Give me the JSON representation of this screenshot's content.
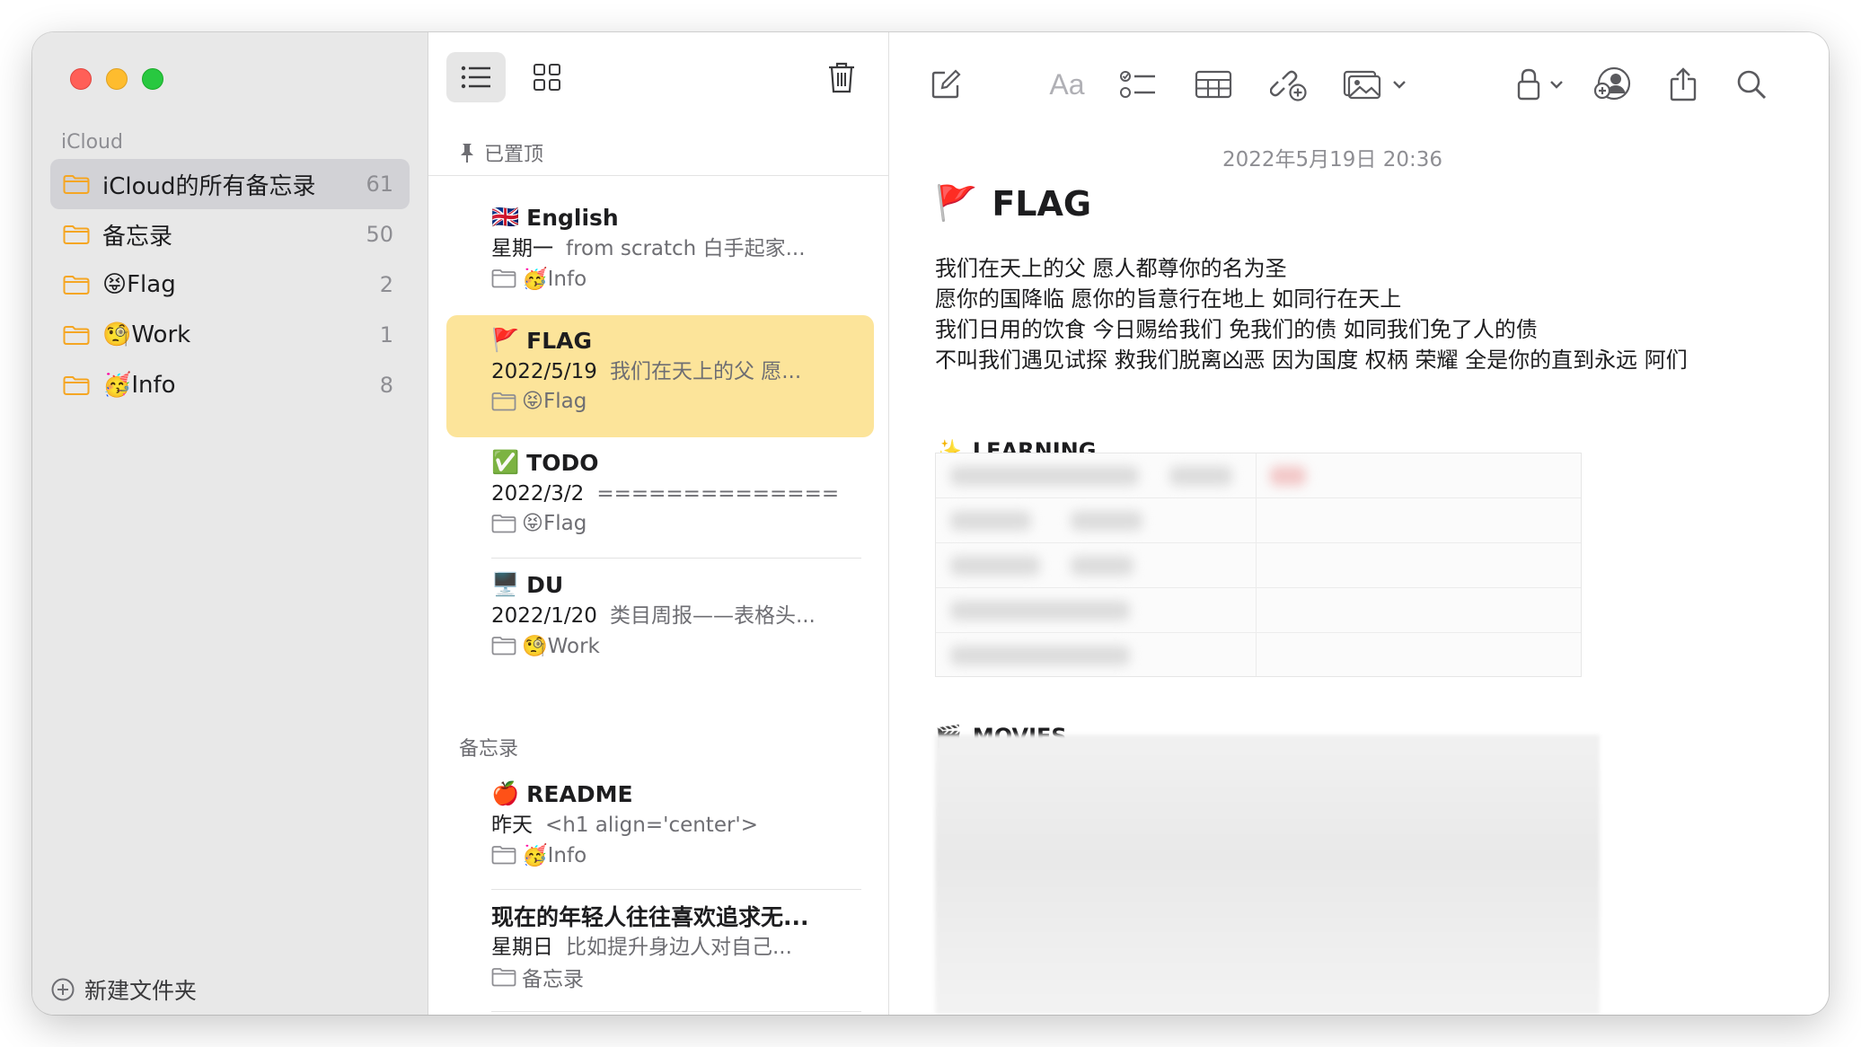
{
  "window": {
    "traffic_lights": {
      "close": "#ff5f57",
      "minimize": "#febc2e",
      "maximize": "#28c840"
    }
  },
  "sidebar": {
    "account_label": "iCloud",
    "folders": [
      {
        "name": "iCloud的所有备忘录",
        "count": "61",
        "selected": true
      },
      {
        "name": "备忘录",
        "count": "50"
      },
      {
        "name": "😝Flag",
        "count": "2"
      },
      {
        "name": "🧐Work",
        "count": "1"
      },
      {
        "name": "🥳Info",
        "count": "8"
      }
    ],
    "new_folder_label": "新建文件夹",
    "folder_icon_color": "#f5a623"
  },
  "note_list": {
    "toolbar": {
      "list_view_icon": "list-icon",
      "gallery_view_icon": "grid-icon",
      "delete_icon": "trash-icon"
    },
    "pinned_header": "已置顶",
    "pinned_notes": [
      {
        "emoji": "🇬🇧",
        "title": "English",
        "date": "星期一",
        "snippet": "from scratch 白手起家...",
        "folder": "🥳Info"
      },
      {
        "emoji": "🚩",
        "title": "FLAG",
        "date": "2022/5/19",
        "snippet": "我们在天上的父 愿...",
        "folder": "😝Flag",
        "selected": true
      },
      {
        "emoji": "✅",
        "title": "TODO",
        "date": "2022/3/2",
        "snippet": "==============",
        "folder": "😝Flag"
      },
      {
        "emoji": "🖥️",
        "title": "DU",
        "date": "2022/1/20",
        "snippet": "类目周报——表格头...",
        "folder": "🧐Work"
      }
    ],
    "notes_header": "备忘录",
    "notes": [
      {
        "emoji": "🍎",
        "title": "README",
        "date": "昨天",
        "snippet": "<h1 align='center'>",
        "folder": "🥳Info"
      },
      {
        "emoji": "",
        "title": "现在的年轻人往往喜欢追求无...",
        "date": "星期日",
        "snippet": "比如提升身边人对自己...",
        "folder": "备忘录"
      }
    ],
    "selected_color": "#fce49a"
  },
  "editor": {
    "toolbar": {
      "compose": "compose-icon",
      "format_label": "Aa",
      "checklist": "checklist-icon",
      "table": "table-icon",
      "share_link": "link-add-icon",
      "media": "photo-icon",
      "lock": "lock-icon",
      "collaborate": "person-add-icon",
      "share": "share-icon",
      "search": "search-icon"
    },
    "date": "2022年5月19日 20:36",
    "title_emoji": "🚩",
    "title": "FLAG",
    "body_lines": [
      "我们在天上的父 愿人都尊你的名为圣",
      "愿你的国降临 愿你的旨意行在地上 如同行在天上",
      "我们日用的饮食 今日赐给我们 免我们的债 如同我们免了人的债",
      "不叫我们遇见试探 救我们脱离凶恶 因为国度 权柄 荣耀 全是你的直到永远 阿们"
    ],
    "section_learning": {
      "emoji": "✨",
      "label": "LEARNING"
    },
    "section_movies": {
      "emoji": "🎬",
      "label": "MOVIES"
    }
  }
}
